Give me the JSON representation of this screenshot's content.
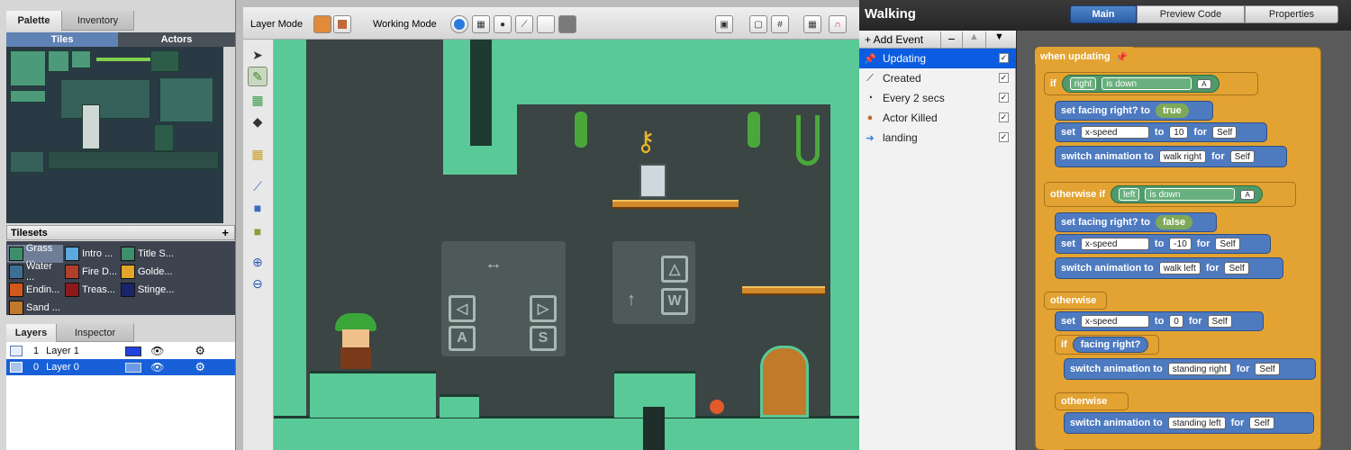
{
  "left_panel": {
    "tabs": [
      "Palette",
      "Inventory"
    ],
    "subtabs": [
      "Tiles",
      "Actors"
    ],
    "tilesets_title": "Tilesets",
    "tilesets_add": "+",
    "tilesets": [
      [
        "Grass ...",
        "Intro ...",
        "Title S..."
      ],
      [
        "Water ...",
        "Fire D...",
        "Golde..."
      ],
      [
        "Endin...",
        "Treas...",
        "Stinge..."
      ],
      [
        "Sand ..."
      ]
    ],
    "tileset_colors": [
      [
        "#3d8f6b",
        "#5aa9e0",
        "#3d8f6b"
      ],
      [
        "#3d6f95",
        "#b0402c",
        "#e0a52a"
      ],
      [
        "#d0581a",
        "#8c1a1a",
        "#1a2466"
      ],
      [
        "#c07a2a"
      ]
    ],
    "bottom_tabs": [
      "Layers",
      "Inspector"
    ],
    "layers": [
      {
        "index": "1",
        "name": "Layer 1",
        "color": "#2040e0"
      },
      {
        "index": "0",
        "name": "Layer 0",
        "color": "#6a9be8"
      }
    ]
  },
  "toolbar": {
    "layer_mode_label": "Layer Mode",
    "working_mode_label": "Working Mode"
  },
  "right_panel": {
    "title": "Walking",
    "tabs": [
      "Main",
      "Preview Code",
      "Properties"
    ],
    "add_event": "+ Add Event",
    "events": [
      {
        "label": "Updating",
        "icon": "pin",
        "checked": true
      },
      {
        "label": "Created",
        "icon": "wand",
        "checked": true
      },
      {
        "label": "Every 2 secs",
        "icon": "clock",
        "checked": true
      },
      {
        "label": "Actor Killed",
        "icon": "person",
        "checked": true
      },
      {
        "label": "landing",
        "icon": "arrow",
        "checked": true
      }
    ]
  },
  "blocks": {
    "when": "when updating",
    "if": "if",
    "right": "right",
    "is_down": "is down",
    "set_facing": "set facing right? to",
    "true": "true",
    "false": "false",
    "set": "set",
    "x_speed": "x-speed",
    "to": "to",
    "for": "for",
    "self": "Self",
    "val_10": "10",
    "val_neg10": "-10",
    "val_0": "0",
    "switch_anim": "switch animation to",
    "walk_right": "walk right",
    "walk_left": "walk left",
    "otherwise_if": "otherwise if",
    "left": "left",
    "otherwise": "otherwise",
    "facing_right": "facing right?",
    "standing_right": "standing right",
    "standing_left": "standing left"
  }
}
